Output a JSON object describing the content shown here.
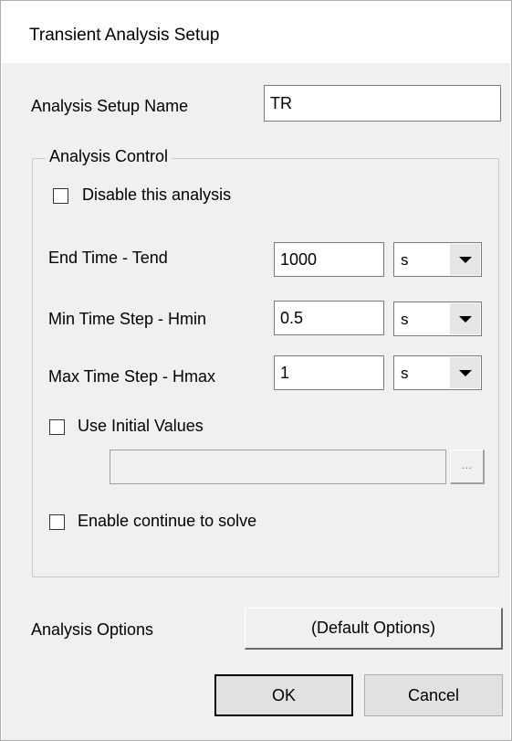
{
  "window": {
    "title": "Transient Analysis Setup"
  },
  "setup_name": {
    "label": "Analysis Setup Name",
    "value": "TR"
  },
  "analysis_control": {
    "legend": "Analysis Control",
    "disable": {
      "label": "Disable this analysis",
      "checked": false
    },
    "end_time": {
      "label": "End Time - Tend",
      "value": "1000",
      "unit": "s"
    },
    "min_step": {
      "label": "Min Time Step - Hmin",
      "value": "0.5",
      "unit": "s"
    },
    "max_step": {
      "label": "Max Time Step - Hmax",
      "value": "1",
      "unit": "s"
    },
    "initial_values": {
      "label": "Use Initial Values",
      "checked": false,
      "path": "",
      "browse_label": "..."
    },
    "continue_solve": {
      "label": "Enable continue to solve",
      "checked": false
    }
  },
  "analysis_options": {
    "label": "Analysis Options",
    "button": "(Default Options)"
  },
  "buttons": {
    "ok": "OK",
    "cancel": "Cancel"
  }
}
